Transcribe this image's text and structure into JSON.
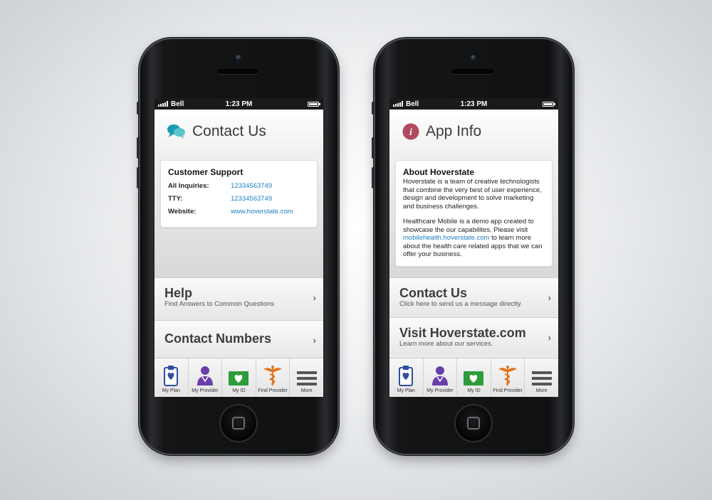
{
  "status_bar": {
    "carrier": "Bell",
    "time": "1:23 PM"
  },
  "contact_screen": {
    "title": "Contact Us",
    "card": {
      "heading": "Customer Support",
      "rows": [
        {
          "label": "All Inquiries:",
          "value": "12334563749"
        },
        {
          "label": "TTY:",
          "value": "12334563749"
        },
        {
          "label": "Website:",
          "value": "www.hoverstate.com"
        }
      ]
    },
    "nav": [
      {
        "title": "Help",
        "subtitle": "Find Answers to Common Questions"
      },
      {
        "title": "Contact Numbers",
        "subtitle": ""
      }
    ]
  },
  "info_screen": {
    "title": "App Info",
    "card": {
      "heading": "About Hoverstate",
      "para1": "Hoverstate is a team of creative technologists that combine the very best of user experience, design and development to solve marketing and business challenges.",
      "para2_before": "Healthcare Mobile is a demo app created to showcase the our capabilites.  Please visit ",
      "para2_link": "mobilehealth.hoverstate.com",
      "para2_after": " to learn more about the health care related apps that we can offer your business."
    },
    "nav": [
      {
        "title": "Contact Us",
        "subtitle": "Click here to send us a message directly."
      },
      {
        "title": "Visit Hoverstate.com",
        "subtitle": "Learn more about our services."
      }
    ]
  },
  "tabs": [
    {
      "label": "My Plan",
      "icon": "clipboard-heart-icon"
    },
    {
      "label": "My Provider",
      "icon": "doctor-icon"
    },
    {
      "label": "My ID",
      "icon": "id-card-heart-icon"
    },
    {
      "label": "Find Provider",
      "icon": "caduceus-icon"
    },
    {
      "label": "More",
      "icon": "menu-lines-icon"
    }
  ],
  "colors": {
    "contact_accent": "#1a9bb0",
    "info_accent": "#b04a5e",
    "link": "#1b7fc3",
    "plan_icon": "#2f4ea0",
    "provider_icon": "#6a3fa8",
    "id_icon": "#2e9c3a",
    "find_icon": "#e4741c",
    "more_icon": "#555555"
  }
}
